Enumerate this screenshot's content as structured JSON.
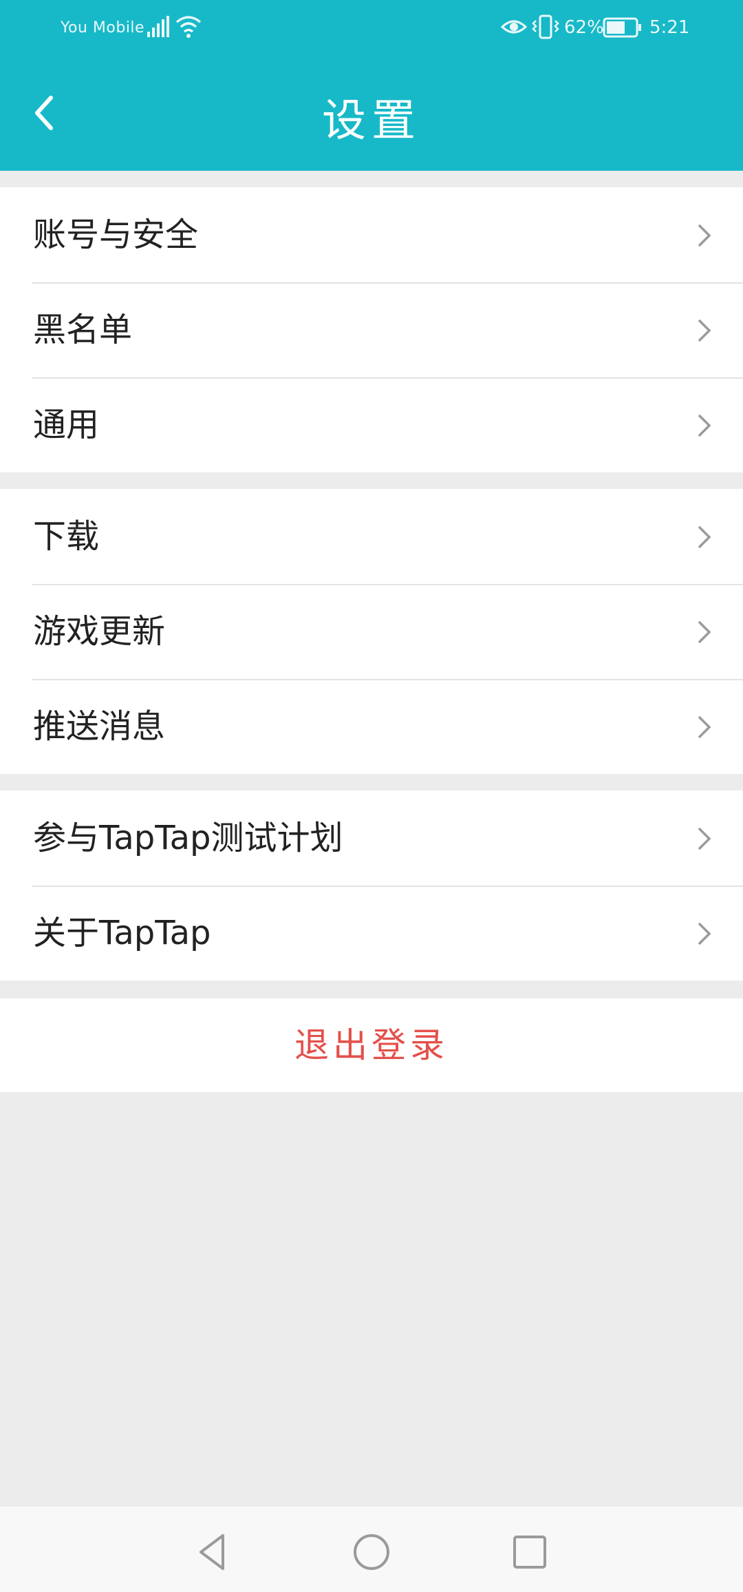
{
  "status_bar": {
    "carrier": "You Mobile",
    "battery": "62%",
    "time": "5:21",
    "icons": [
      "signal-icon",
      "wifi-icon",
      "eye-icon",
      "vibrate-icon",
      "battery-icon"
    ]
  },
  "header": {
    "title": "设置",
    "back_icon": "chevron-left-icon",
    "color": "#17b9c8"
  },
  "groups": [
    {
      "items": [
        "账号与安全",
        "黑名单",
        "通用"
      ]
    },
    {
      "items": [
        "下载",
        "游戏更新",
        "推送消息"
      ]
    },
    {
      "items": [
        "参与TapTap测试计划",
        "关于TapTap"
      ]
    }
  ],
  "logout": {
    "label": "退出登录",
    "color": "#e4504a"
  },
  "navbar": {
    "icons": [
      "back-triangle-icon",
      "home-circle-icon",
      "recents-square-icon"
    ]
  }
}
